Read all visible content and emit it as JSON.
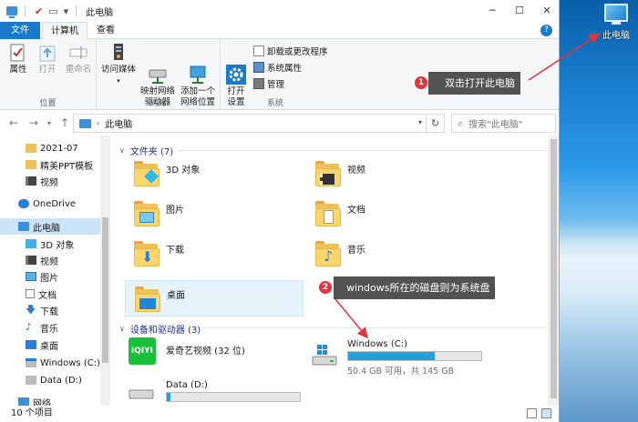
{
  "window": {
    "title": "此电脑",
    "controls": {
      "minimize": "─",
      "maximize": "☐",
      "close": "✕"
    }
  },
  "quick_access": {
    "dropdown": "▾"
  },
  "ribbon_tabs": [
    {
      "label": "文件"
    },
    {
      "label": "计算机"
    },
    {
      "label": "查看"
    }
  ],
  "ribbon": {
    "location": {
      "group_label": "位置",
      "buttons": [
        "属性",
        "打开",
        "重命名"
      ]
    },
    "network": {
      "group_label": "网络",
      "buttons": [
        "访问媒体",
        "映射网络\n驱动器",
        "添加一个\n网络位置"
      ]
    },
    "system": {
      "group_label": "系统",
      "open_settings": "打开\n设置",
      "items": [
        "卸载或更改程序",
        "系统属性",
        "管理"
      ]
    }
  },
  "address_bar": {
    "path": "此电脑",
    "search_placeholder": "搜索\"此电脑\""
  },
  "nav_pane": [
    {
      "label": "2021-07",
      "icon": "folder"
    },
    {
      "label": "精美PPT模板",
      "icon": "folder"
    },
    {
      "label": "视频",
      "icon": "video"
    },
    {
      "label": "OneDrive",
      "icon": "cloud"
    },
    {
      "label": "此电脑",
      "icon": "pc",
      "selected": true
    },
    {
      "label": "3D 对象",
      "icon": "cube"
    },
    {
      "label": "视频",
      "icon": "video"
    },
    {
      "label": "图片",
      "icon": "picture"
    },
    {
      "label": "文档",
      "icon": "document"
    },
    {
      "label": "下载",
      "icon": "download"
    },
    {
      "label": "音乐",
      "icon": "music"
    },
    {
      "label": "桌面",
      "icon": "desktop"
    },
    {
      "label": "Windows (C:)",
      "icon": "drive"
    },
    {
      "label": "Data (D:)",
      "icon": "drive"
    },
    {
      "label": "网络",
      "icon": "network"
    }
  ],
  "folders_section": {
    "label": "文件夹 (7)"
  },
  "folders": [
    {
      "name": "3D 对象",
      "overlay": "cube"
    },
    {
      "name": "视频",
      "overlay": "film"
    },
    {
      "name": "图片",
      "overlay": "picture"
    },
    {
      "name": "文档",
      "overlay": "document"
    },
    {
      "name": "下载",
      "overlay": "download"
    },
    {
      "name": "音乐",
      "overlay": "music"
    },
    {
      "name": "桌面",
      "overlay": "desktop",
      "selected": true
    }
  ],
  "devices_section": {
    "label": "设备和驱动器 (3)"
  },
  "devices": [
    {
      "name": "爱奇艺视频 (32 位)",
      "icon": "iqiyi"
    },
    {
      "name": "Windows (C:)",
      "usage": "50.4 GB 可用，共 145 GB",
      "used_fraction": 0.65
    },
    {
      "name": "Data (D:)",
      "used_fraction": 0.03
    }
  ],
  "status_bar": {
    "count": "10 个项目"
  },
  "annotations": [
    {
      "number": "1",
      "text": "双击打开此电脑"
    },
    {
      "number": "2",
      "text": "windows所在的磁盘则为系统盘"
    }
  ],
  "desktop_icon": {
    "label": "此电脑"
  },
  "colors": {
    "accent": "#1979ca",
    "drive_fill": "#26a0da",
    "callout_bg": "#525252",
    "badge": "#e8313a",
    "arrow": "#e8313a"
  }
}
